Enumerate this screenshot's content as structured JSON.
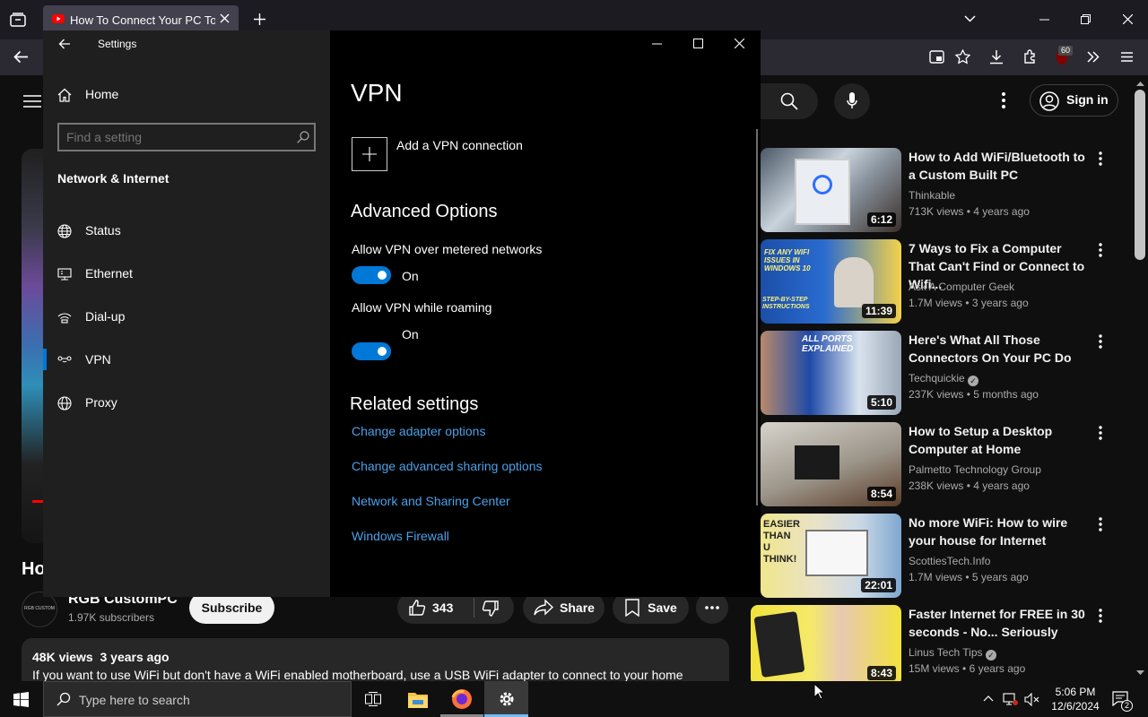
{
  "browser": {
    "tab_title": "How To Connect Your PC To Th",
    "notification_badge": "60"
  },
  "youtube": {
    "sign_in": "Sign in",
    "video_title_partial": "Ho",
    "channel": {
      "name": "RGB CustomPC",
      "subscribers": "1.97K subscribers",
      "avatar_text": "RGB CUSTOM"
    },
    "subscribe_label": "Subscribe",
    "likes": "343",
    "share_label": "Share",
    "save_label": "Save",
    "description": {
      "views": "48K views",
      "age": "3 years ago",
      "text": "If you want to use WiFi but don't have a WiFi enabled motherboard, use a USB WiFi adapter to connect to your home"
    },
    "recommendations": [
      {
        "title": "How to Add WiFi/Bluetooth to a Custom Built PC",
        "channel": "Thinkable",
        "verified": false,
        "views": "713K views",
        "age": "4 years ago",
        "duration": "6:12"
      },
      {
        "title": "7 Ways to Fix a Computer That Can't Find or Connect to Wifi...",
        "channel": "Ask A Computer Geek",
        "verified": false,
        "views": "1.7M views",
        "age": "3 years ago",
        "duration": "11:39"
      },
      {
        "title": "Here's What All Those Connectors On Your PC Do",
        "channel": "Techquickie",
        "verified": true,
        "views": "237K views",
        "age": "5 months ago",
        "duration": "5:10"
      },
      {
        "title": "How to Setup a Desktop Computer at Home",
        "channel": "Palmetto Technology Group",
        "verified": false,
        "views": "238K views",
        "age": "4 years ago",
        "duration": "8:54"
      },
      {
        "title": "No more WiFi: How to wire your house for Internet",
        "channel": "ScottiesTech.Info",
        "verified": false,
        "views": "1.7M views",
        "age": "5 years ago",
        "duration": "22:01"
      },
      {
        "title": "Faster Internet for FREE in 30 seconds - No... Seriously",
        "channel": "Linus Tech Tips",
        "verified": true,
        "views": "15M views",
        "age": "6 years ago",
        "duration": "8:43"
      }
    ],
    "thumb_texts": {
      "t2": "FIX ANY WIFI ISSUES IN WINDOWS 10",
      "t2b": "STEP-BY-STEP INSTRUCTIONS",
      "t3": "ALL PORTS EXPLAINED",
      "t5": "EASIER THAN U THINK!"
    }
  },
  "settings": {
    "window_title": "Settings",
    "home_label": "Home",
    "search_placeholder": "Find a setting",
    "section_label": "Network & Internet",
    "nav": [
      {
        "label": "Status",
        "icon": "globe-icon"
      },
      {
        "label": "Ethernet",
        "icon": "ethernet-icon"
      },
      {
        "label": "Dial-up",
        "icon": "dial-up-icon"
      },
      {
        "label": "VPN",
        "icon": "vpn-icon",
        "selected": true
      },
      {
        "label": "Proxy",
        "icon": "globe-icon"
      }
    ],
    "page_title": "VPN",
    "add_vpn_label": "Add a VPN connection",
    "advanced_heading": "Advanced Options",
    "option_metered_label": "Allow VPN over metered networks",
    "option_metered_state": "On",
    "option_roaming_label": "Allow VPN while roaming",
    "option_roaming_state": "On",
    "related_heading": "Related settings",
    "related_links": [
      "Change adapter options",
      "Change advanced sharing options",
      "Network and Sharing Center",
      "Windows Firewall"
    ],
    "accent_color": "#0078d7"
  },
  "taskbar": {
    "search_placeholder": "Type here to search",
    "time": "5:06 PM",
    "date": "12/6/2024",
    "notification_count": "2"
  }
}
